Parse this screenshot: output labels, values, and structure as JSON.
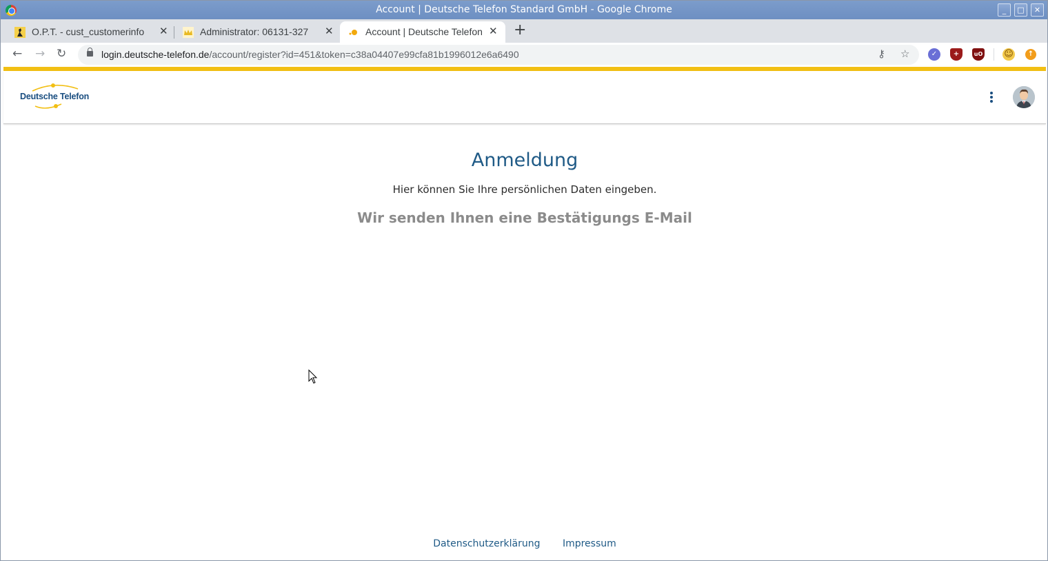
{
  "window": {
    "title": "Account | Deutsche Telefon Standard GmbH - Google Chrome",
    "minimize_glyph": "_",
    "maximize_glyph": "□",
    "close_glyph": "✕"
  },
  "tabs": [
    {
      "label": "O.P.T. - cust_customerinfo",
      "icon": "kangaroo-icon",
      "active": false
    },
    {
      "label": "Administrator: 06131-327",
      "icon": "admin-crown-icon",
      "active": false
    },
    {
      "label": "Account | Deutsche Telefon",
      "icon": "deutsche-telefon-icon",
      "active": true
    }
  ],
  "tab_close_glyph": "✕",
  "new_tab_glyph": "+",
  "toolbar": {
    "back_glyph": "←",
    "forward_glyph": "→",
    "reload_glyph": "↻",
    "url_host": "login.deutsche-telefon.de",
    "url_path": "/account/register?id=451&token=c38a04407e99cfa81b1996012e6a6490",
    "key_glyph": "⚷",
    "star_glyph": "☆"
  },
  "extensions": [
    {
      "name": "check-extension-icon",
      "color": "#6a6fd6",
      "glyph": "✓"
    },
    {
      "name": "shield-plus-extension-icon",
      "color": "#9b1b1b",
      "glyph": "+"
    },
    {
      "name": "ublock-origin-icon",
      "color": "#7f1010",
      "glyph": "uO"
    },
    {
      "name": "emoji-extension-icon",
      "color": "#f2c94c",
      "glyph": "☺"
    },
    {
      "name": "update-extension-icon",
      "color": "#f29d1b",
      "glyph": "↑"
    }
  ],
  "colors": {
    "accent_bar": "#f2bf13",
    "brand_blue": "#1f5a86",
    "muted_gray": "#8b8b8b"
  },
  "app": {
    "logo_text": "Deutsche Telefon"
  },
  "main": {
    "heading": "Anmeldung",
    "subtitle": "Hier können Sie Ihre persönlichen Daten eingeben.",
    "confirmation": "Wir senden Ihnen eine Bestätigungs E-Mail"
  },
  "footer": {
    "privacy_link": "Datenschutzerklärung",
    "imprint_link": "Impressum"
  }
}
